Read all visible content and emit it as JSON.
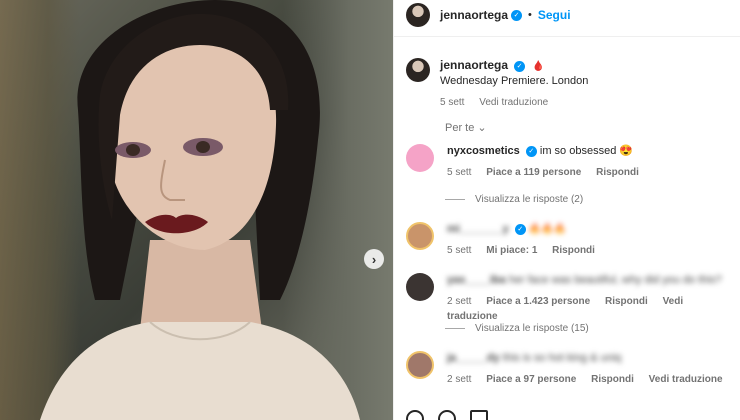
{
  "post": {
    "username": "jennaortega",
    "follow_label": "Segui",
    "separator": "•",
    "caption_text": "Wednesday Premiere. London",
    "caption_emoji": "🩸",
    "caption_time": "5 sett",
    "caption_translate": "Vedi traduzione",
    "next_icon": "chevron-right-icon"
  },
  "sort": {
    "label": "Per te ⌄"
  },
  "comments": [
    {
      "user": "nyxcosmetics",
      "verified": true,
      "text": "im so obsessed 😍",
      "time": "5 sett",
      "likes": "Piace a 119 persone",
      "reply": "Rispondi",
      "translate": "",
      "avatar_color": "#f5a3c7",
      "replies": "Visualizza le risposte (2)"
    },
    {
      "user": "mi_______y",
      "verified": true,
      "text": "🔥🔥🔥",
      "time": "5 sett",
      "likes": "Mi piace: 1",
      "reply": "Rispondi",
      "translate": "",
      "avatar_color": "#c9946a",
      "replies": ""
    },
    {
      "user": "yas____iba",
      "verified": false,
      "text": "her face was beautiful, why did you do this?",
      "time": "2 sett",
      "likes": "Piace a 1.423 persone",
      "reply": "Rispondi",
      "translate": "Vedi traduzione",
      "avatar_color": "#3b3432",
      "replies": "Visualizza le risposte (15)"
    },
    {
      "user": "ja_____dy",
      "verified": false,
      "text": "this is so hot king & uniq",
      "time": "2 sett",
      "likes": "Piace a 97 persone",
      "reply": "Rispondi",
      "translate": "Vedi traduzione",
      "avatar_color": "#a0786a",
      "replies": ""
    }
  ],
  "colors": {
    "accent": "#0095f6",
    "muted": "#737373",
    "text": "#262626"
  }
}
